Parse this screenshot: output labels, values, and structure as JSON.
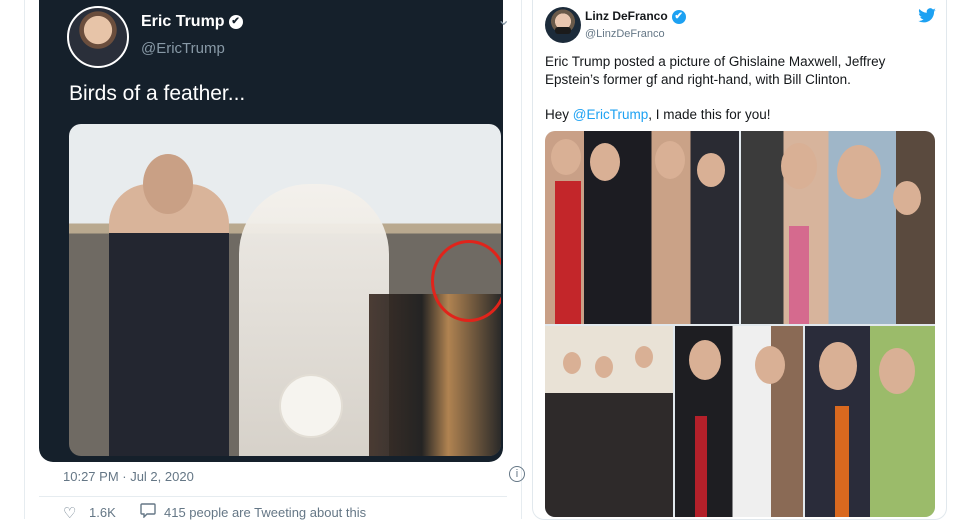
{
  "left_tweet": {
    "author_name": "Eric Trump",
    "verified_icon": "✔",
    "handle": "@EricTrump",
    "text": "Birds of a feather...",
    "timestamp": "10:27 PM · Jul 2, 2020",
    "info_icon": "i",
    "likes": "1.6K",
    "talking": "415 people are Tweeting about this",
    "chevron": "⌄",
    "heart_icon": "♡",
    "bubble_icon": "💬"
  },
  "right_tweet": {
    "author_name": "Linz DeFranco",
    "verified_icon": "✔",
    "handle": "@LinzDeFranco",
    "text": "Eric Trump posted a picture of Ghislaine Maxwell, Jeffrey Epstein’s former gf and right-hand, with Bill Clinton.",
    "reply_prefix": "Hey ",
    "reply_mention": "@EricTrump",
    "reply_suffix": ", I made this for you!"
  },
  "colors": {
    "dark_bg": "#15202b",
    "twitter_blue": "#1da1f2",
    "circle_red": "#e0241b",
    "muted": "#657786"
  }
}
